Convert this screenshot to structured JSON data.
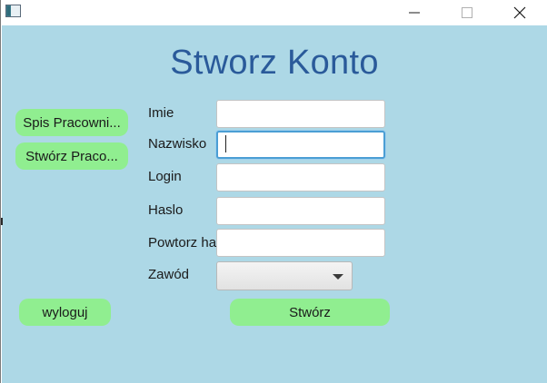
{
  "window": {
    "icon": "app-window-icon",
    "controls": {
      "minimize_icon": "minimize-icon",
      "maximize_icon": "maximize-icon",
      "close_icon": "close-icon"
    }
  },
  "page": {
    "title": "Stworz Konto",
    "title_color": "#2a5a9a",
    "background": "#add8e6",
    "button_color": "#90ee90"
  },
  "sidebar": {
    "items": [
      {
        "label": "Spis Pracowni..."
      },
      {
        "label": "Stwórz Praco..."
      }
    ],
    "logout_label": "wyloguj"
  },
  "form": {
    "fields": [
      {
        "label": "Imie",
        "value": ""
      },
      {
        "label": "Nazwisko",
        "value": ""
      },
      {
        "label": "Login",
        "value": ""
      },
      {
        "label": "Haslo",
        "value": ""
      },
      {
        "label": "Powtorz ha",
        "value": ""
      }
    ],
    "occupation": {
      "label": "Zawód",
      "selected": ""
    },
    "submit_label": "Stwórz"
  }
}
